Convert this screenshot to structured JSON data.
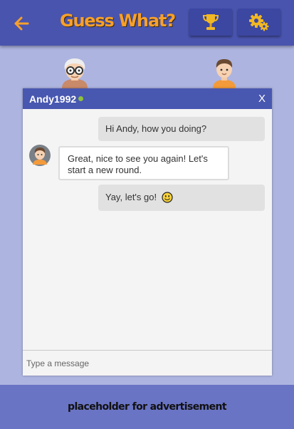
{
  "header": {
    "title": "Guess What?",
    "back_icon": "arrow-left-icon",
    "trophy_icon": "trophy-icon",
    "settings_icon": "gears-icon"
  },
  "players": {
    "left_avatar": "grandpa-avatar",
    "right_avatar": "boy-avatar"
  },
  "chat": {
    "username": "Andy1992",
    "online": true,
    "close_label": "X",
    "messages": [
      {
        "from": "me",
        "text": "Hi Andy, how you doing?"
      },
      {
        "from": "Andy1992",
        "text": "Great, nice to see you again! Let's start a new round."
      },
      {
        "from": "me",
        "text": "Yay, let's go!",
        "emoji": "smiley-icon"
      }
    ],
    "input_placeholder": "Type a message"
  },
  "ad": {
    "text": "placeholder for advertisement"
  },
  "colors": {
    "header_bg": "#4954ae",
    "title": "#f7a02a",
    "page_bg": "#adb4e0",
    "chat_header": "#4857b0",
    "ad_bg": "#6a74c4",
    "online": "#8fc23a"
  }
}
